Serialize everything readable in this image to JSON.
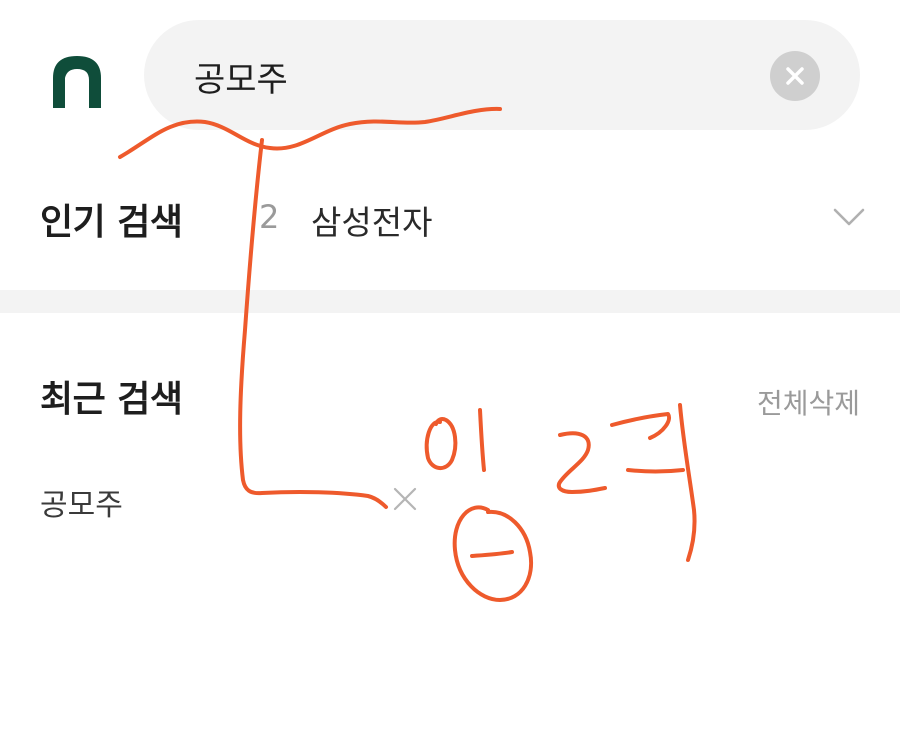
{
  "header": {
    "logo_icon": "brand-logo-icon",
    "search": {
      "value": "공모주",
      "placeholder": "",
      "clear_icon": "clear-circle-icon"
    }
  },
  "popular": {
    "title": "인기 검색",
    "rank": "2",
    "keyword": "삼성전자",
    "expand_icon": "chevron-down-icon"
  },
  "recent": {
    "title": "최근 검색",
    "delete_all_label": "전체삭제",
    "items": [
      {
        "label": "공모주",
        "remove_icon": "close-icon"
      }
    ]
  },
  "annotation": {
    "handwritten_text": "입력",
    "color": "#ee5a2c"
  },
  "colors": {
    "brand": "#0f4d3a",
    "search_bg": "#f3f3f3",
    "clear_bg": "#cfcfcf",
    "muted_text": "#9a9a9a"
  }
}
